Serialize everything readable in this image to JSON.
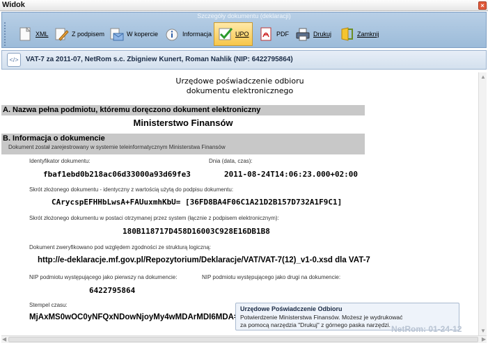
{
  "window": {
    "title": "Widok",
    "close_label": "×"
  },
  "ribbon": {
    "caption": "Szczegóły dokumentu (deklaracji)",
    "buttons": [
      {
        "label": "XML",
        "icon": "document-icon"
      },
      {
        "label": "Z podpisem",
        "icon": "signature-pen-icon"
      },
      {
        "label": "W kopercie",
        "icon": "envelope-icon"
      },
      {
        "label": "Informacja",
        "icon": "info-icon"
      },
      {
        "label": "UPO",
        "icon": "checkmark-icon",
        "active": true
      },
      {
        "label": "PDF",
        "icon": "pdf-icon"
      },
      {
        "label": "Drukuj",
        "icon": "printer-icon"
      },
      {
        "label": "Zamknij",
        "icon": "close-door-icon"
      }
    ]
  },
  "document_header": {
    "badge": "</>",
    "text": "VAT-7 za 2011-07, NetRom s.c. Zbigniew Kunert, Roman Nahlik (NIP: 6422795864)"
  },
  "upo": {
    "title_line1": "Urzędowe poświadczenie odbioru",
    "title_line2": "dokumentu elektronicznego",
    "section_a": "A. Nazwa pełna podmiotu, któremu doręczono dokument elektroniczny",
    "recipient": "Ministerstwo Finansów",
    "section_b": "B. Informacja o dokumencie",
    "registered_note": "Dokument został zarejestrowany w systemie teleinformatycznym Ministerstwa Finansów",
    "id_label": "Identyfikator dokumentu:",
    "id_value": "fbaf1ebd0b218ac06d33000a93d69fe3",
    "date_label": "Dnia (data, czas):",
    "date_value": "2011-08-24T14:06:23.000+02:00",
    "hash_signed_label": "Skrót złożonego dokumentu - identyczny z wartością użytą do podpisu dokumentu:",
    "hash_signed_value": "CArycspEFHHbLwsA+FAUuxmhKbU= [36FD8BA4F06C1A21D2B157D732A1F9C1]",
    "hash_received_label": "Skrót złożonego dokumentu w postaci otrzymanej przez system (łącznie z podpisem elektronicznym):",
    "hash_received_value": "180B118717D458D16003C928E16DB1B8",
    "verified_label": "Dokument zweryfikowano pod względem zgodności ze strukturą logiczną:",
    "verified_value": "http://e-deklaracje.mf.gov.pl/Repozytorium/Deklaracje/VAT/VAT-7(12)_v1-0.xsd dla VAT-7",
    "nip_first_label": "NIP podmiotu występującego jako pierwszy na dokumencie:",
    "nip_second_label": "NIP podmiotu występującego jako drugi na dokumencie:",
    "nip_first_value": "6422795864",
    "timestamp_label": "Stempel czasu:",
    "timestamp_value": "MjAxMS0wOC0yNFQxNDowNjoyMy4wMDArMDI6MDA="
  },
  "tooltip": {
    "title": "Urzędowe Poświadczenie Odbioru",
    "line1": "Potwierdzenie Ministerstwa Finansów. Możesz je wydrukować",
    "line2": "za pomocą narzędzia \"Drukuj\" z górnego paska narzędzi."
  },
  "watermark": "NetRom: 01-24-12"
}
